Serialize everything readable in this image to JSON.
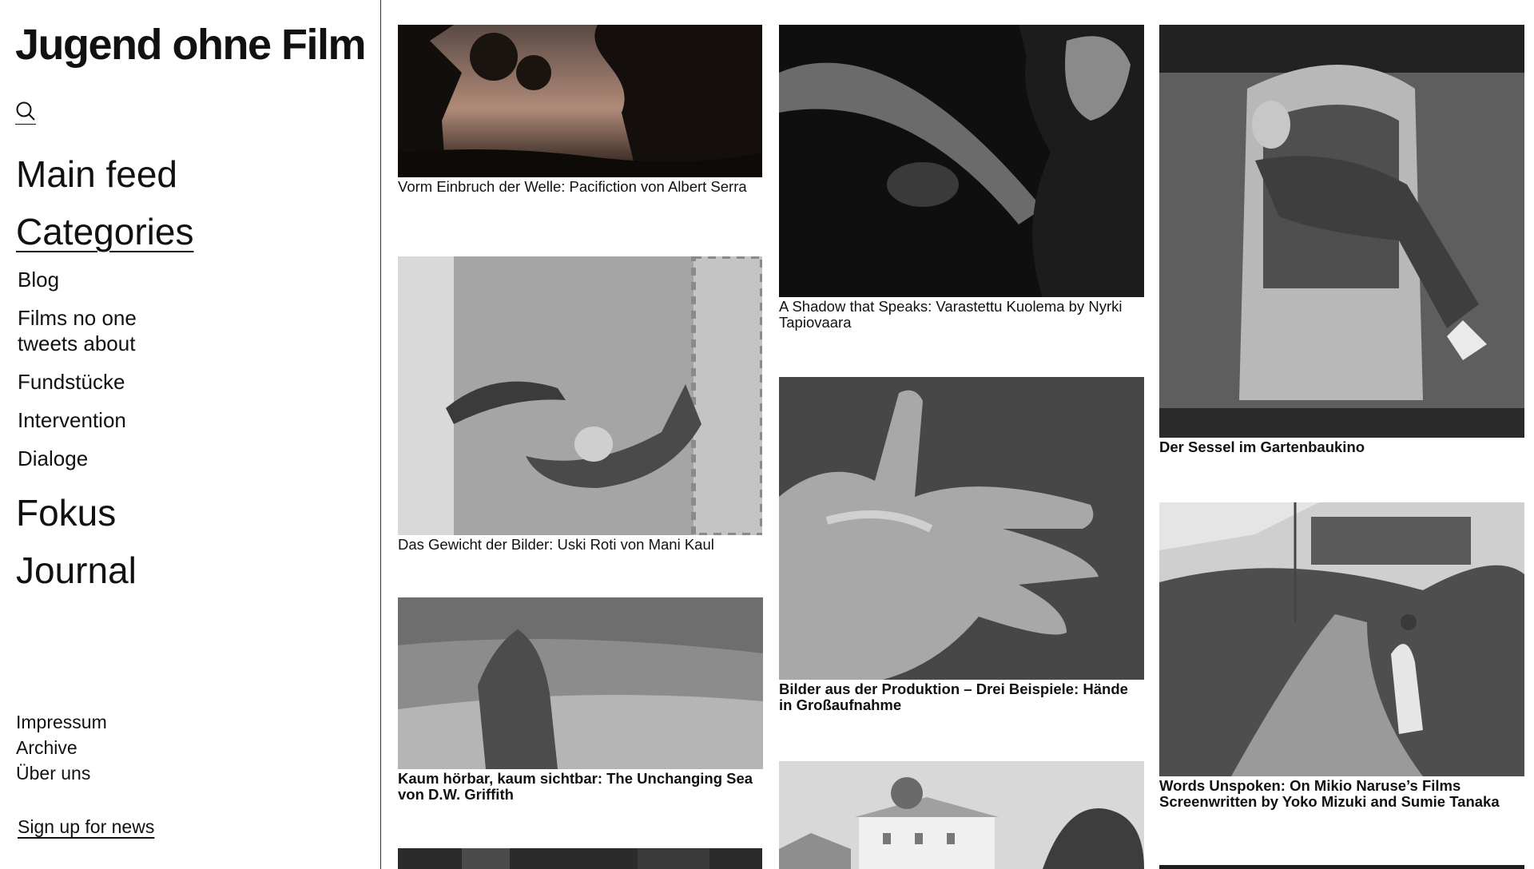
{
  "site": {
    "title": "Jugend ohne Film"
  },
  "nav": {
    "search_icon": "search-icon",
    "main_feed": "Main feed",
    "categories_label": "Categories",
    "categories": [
      "Blog",
      "Films no one tweets about",
      "Fundstücke",
      "Intervention",
      "Dialoge"
    ],
    "fokus": "Fokus",
    "journal": "Journal"
  },
  "footer": {
    "links": [
      "Impressum",
      "Archive",
      "Über uns"
    ],
    "signup": "Sign up for news"
  },
  "feed": {
    "columns": [
      [
        {
          "caption": "Vorm Einbruch der Welle: Pacifiction von Albert Serra",
          "bold": false,
          "image": "sunset-trees-silhouette"
        },
        {
          "caption": "Das Gewicht der Bilder: Uski Roti von Mani Kaul",
          "bold": false,
          "image": "hands-bread"
        },
        {
          "caption": "Kaum hörbar, kaum sichtbar: The Unchanging Sea von D.W. Griffith",
          "bold": true,
          "image": "figure-on-beach"
        },
        {
          "caption": "",
          "bold": false,
          "image": "dark-forest"
        }
      ],
      [
        {
          "caption": "A Shadow that Speaks: Varastettu Kuolema by Nyrki Tapiovaara",
          "bold": false,
          "image": "umbrella-couple"
        },
        {
          "caption": "Bilder aus der Produktion – Drei Beispiele: Hände in Großaufnahme",
          "bold": true,
          "image": "hand-closeup"
        },
        {
          "caption": "",
          "bold": false,
          "image": "farmhouse"
        }
      ],
      [
        {
          "caption": "Der Sessel im Gartenbaukino",
          "bold": true,
          "image": "man-on-throne"
        },
        {
          "caption": "Words Unspoken: On Mikio Naruse’s Films Screenwritten by Yoko Mizuki and Sumie Tanaka",
          "bold": true,
          "image": "woman-path-train"
        },
        {
          "caption": "",
          "bold": false,
          "image": "dark-still"
        }
      ]
    ]
  }
}
